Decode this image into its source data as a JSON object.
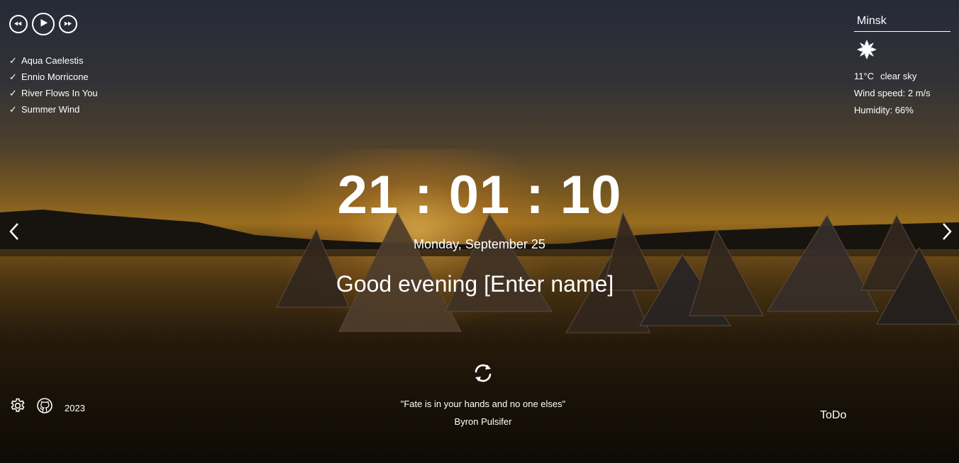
{
  "player": {
    "controls": {
      "prev_icon": "rewind-icon",
      "play_icon": "play-icon",
      "next_icon": "fast-forward-icon"
    },
    "playlist": [
      {
        "title": "Aqua Caelestis"
      },
      {
        "title": "Ennio Morricone"
      },
      {
        "title": "River Flows In You"
      },
      {
        "title": "Summer Wind"
      }
    ],
    "check_glyph": "✓"
  },
  "weather": {
    "city": "Minsk",
    "icon": "clear-sky-sun-icon",
    "temperature": "11°C",
    "description": "clear sky",
    "wind": "Wind speed: 2 m/s",
    "humidity": "Humidity: 66%"
  },
  "clock": {
    "time": "21 : 01 : 10",
    "date": "Monday, September 25"
  },
  "greeting": {
    "text": "Good evening ",
    "name_placeholder": "[Enter name]"
  },
  "slider": {
    "prev_icon": "chevron-left-icon",
    "next_icon": "chevron-right-icon"
  },
  "quote": {
    "refresh_icon": "refresh-icon",
    "text": "\"Fate is in your hands and no one elses\"",
    "author": "Byron Pulsifer"
  },
  "footer": {
    "settings_icon": "gear-icon",
    "github_icon": "github-icon",
    "year": "2023",
    "todo_label": "ToDo"
  },
  "colors": {
    "text": "#ffffff",
    "sky_top": "#2b3140",
    "sunset": "#b07e24",
    "water": "#150f08"
  }
}
